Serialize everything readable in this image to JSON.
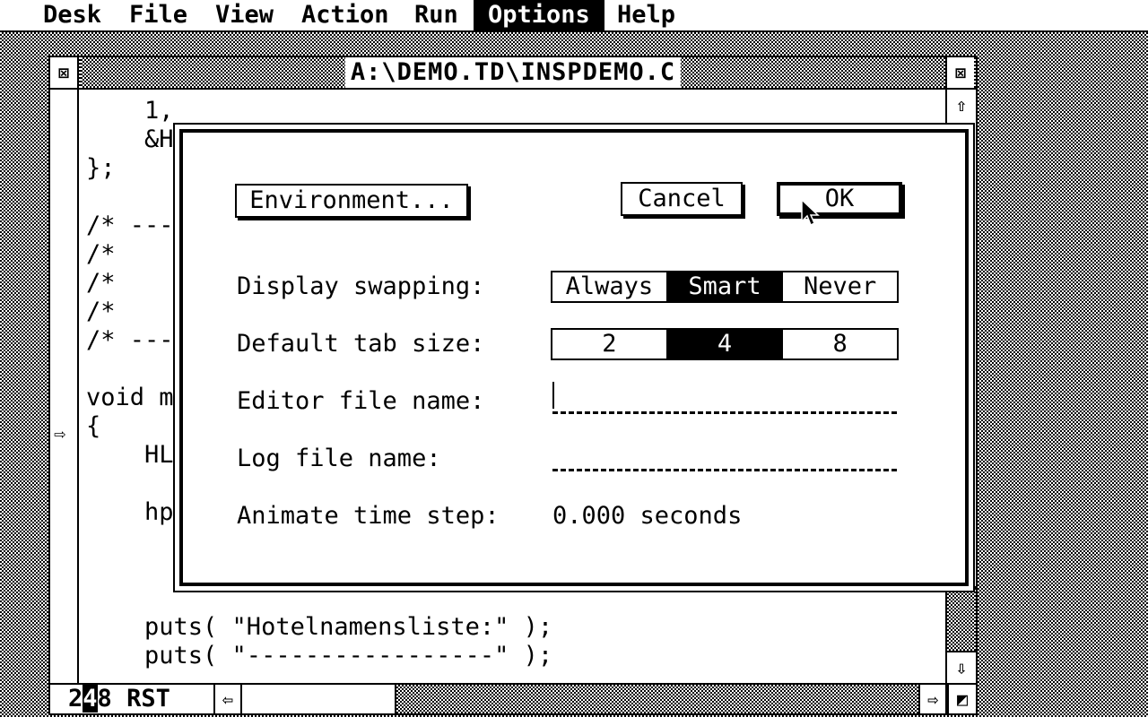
{
  "menubar": {
    "items": [
      "Desk",
      "File",
      "View",
      "Action",
      "Run",
      "Options",
      "Help"
    ],
    "active": "Options"
  },
  "window": {
    "title": "A:\\DEMO.TD\\INSPDEMO.C",
    "close_icon": "close-icon",
    "full_icon": "fuller-icon"
  },
  "code": {
    "lines": [
      "    1,",
      "    &H",
      "};",
      "",
      "/* ---",
      "/*",
      "/*",
      "/*",
      "/* ---",
      "",
      "void m",
      "{",
      "    HL",
      "",
      "    hp",
      "",
      "",
      "",
      "    puts( \"Hotelnamensliste:\" );",
      "    puts( \"-----------------\" );"
    ]
  },
  "status": {
    "tab_2": "2",
    "tab_4": "4",
    "tab_8": "8",
    "flags": "RST"
  },
  "dialog": {
    "environment_label": "Environment...",
    "cancel_label": "Cancel",
    "ok_label": "OK",
    "display_swapping": {
      "label": "Display swapping:",
      "options": [
        "Always",
        "Smart",
        "Never"
      ],
      "selected": "Smart"
    },
    "tab_size": {
      "label": "Default tab size:",
      "options": [
        "2",
        "4",
        "8"
      ],
      "selected": "4"
    },
    "editor_file": {
      "label": "Editor file name:",
      "value": ""
    },
    "log_file": {
      "label": "Log file name:",
      "value": ""
    },
    "animate": {
      "label": "Animate time step:",
      "value": "0.000 seconds"
    }
  }
}
